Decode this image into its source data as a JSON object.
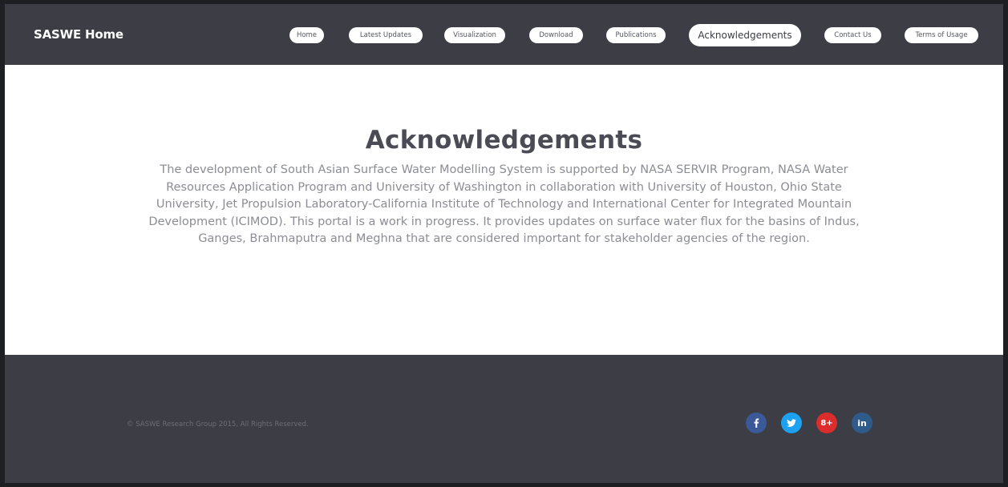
{
  "header": {
    "brand": "SASWE Home",
    "nav": [
      {
        "label": "Home"
      },
      {
        "label": "Latest Updates"
      },
      {
        "label": "Visualization"
      },
      {
        "label": "Download"
      },
      {
        "label": "Publications"
      },
      {
        "label": "Acknowledgements",
        "active": true
      },
      {
        "label": "Contact Us"
      },
      {
        "label": "Terms of Usage"
      }
    ]
  },
  "main": {
    "title": "Acknowledgements",
    "body": "The development of South Asian Surface Water Modelling System is supported by NASA SERVIR Program, NASA Water Resources Application Program and University of Washington in collaboration with University of Houston, Ohio State University, Jet Propulsion Laboratory-California Institute of Technology and International Center for Integrated Mountain Development (ICIMOD). This portal is a work in progress. It provides updates on surface water flux for the basins of Indus, Ganges, Brahmaputra and Meghna that are considered important for stakeholder agencies of the region."
  },
  "footer": {
    "copyright": "© SASWE Research Group 2015, All Rights Reserved.",
    "social": [
      {
        "icon": "facebook-icon",
        "glyph": "f",
        "color": "#3b5998"
      },
      {
        "icon": "twitter-icon",
        "glyph": "",
        "color": "#1da1f2"
      },
      {
        "icon": "google-plus-icon",
        "glyph": "8+",
        "color": "#dd2c2c"
      },
      {
        "icon": "linkedin-icon",
        "glyph": "in",
        "color": "#2f5b8a"
      }
    ]
  },
  "colors": {
    "header_bg": "#3c3d45",
    "page_bg": "#ffffff",
    "title": "#4a4b54",
    "body_text": "#8c8d94"
  }
}
